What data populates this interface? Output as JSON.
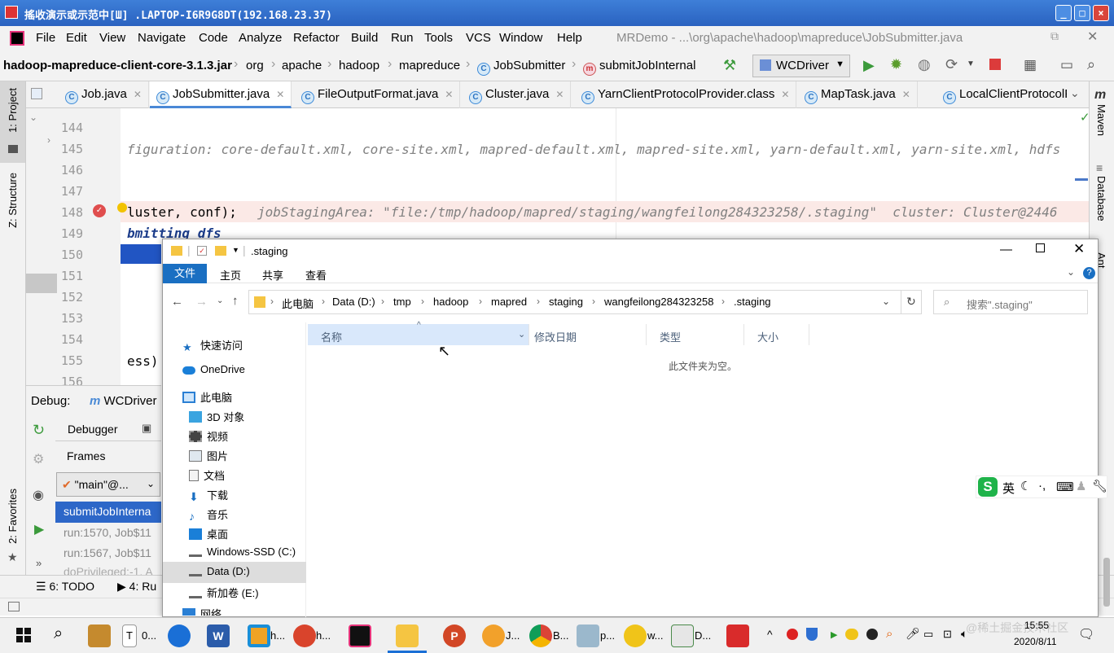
{
  "remote_window": {
    "title": "搖收演示或示范中[Ш] .LAPTOP-I6R9G8DT(192.168.23.37)"
  },
  "menu": [
    "File",
    "Edit",
    "View",
    "Navigate",
    "Code",
    "Analyze",
    "Refactor",
    "Build",
    "Run",
    "Tools",
    "VCS",
    "Window",
    "Help"
  ],
  "project_path": "MRDemo - ...\\org\\apache\\hadoop\\mapreduce\\JobSubmitter.java",
  "breadcrumbs": [
    "hadoop-mapreduce-client-core-3.1.3.jar",
    "org",
    "apache",
    "hadoop",
    "mapreduce",
    "JobSubmitter",
    "submitJobInternal"
  ],
  "run_config": "WCDriver",
  "tabs": [
    "Job.java",
    "JobSubmitter.java",
    "FileOutputFormat.java",
    "Cluster.java",
    "YarnClientProtocolProvider.class",
    "MapTask.java",
    "LocalClientProtocolPr"
  ],
  "left_tools": {
    "project": "1: Project",
    "structure": "Z: Structure",
    "favorites": "2: Favorites"
  },
  "right_tools": {
    "maven": "Maven",
    "database": "Database",
    "ant": "Ant"
  },
  "line_numbers": [
    "144",
    "145",
    "146",
    "147",
    "148",
    "149",
    "150",
    "151",
    "152",
    "153",
    "154",
    "155",
    "156"
  ],
  "code": {
    "l145": "figuration: core-default.xml, core-site.xml, mapred-default.xml, mapred-site.xml, yarn-default.xml, yarn-site.xml, hdfs",
    "l148_code": "luster, conf);",
    "l148_hint": "jobStagingArea: \"file:/tmp/hadoop/mapred/staging/wangfeilong284323258/.staging\"  cluster: Cluster@2446",
    "l149": "bmitting dfs",
    "l155": "ess)"
  },
  "debug": {
    "label": "Debug:",
    "config": "WCDriver",
    "debugger_tab": "Debugger",
    "frames_label": "Frames",
    "thread": "\"main\"@...",
    "frames": [
      "submitJobInterna",
      "run:1570, Job$11",
      "run:1567, Job$11",
      "doPrivileged:-1, A"
    ]
  },
  "bottom_tools": {
    "todo": "6: TODO",
    "run": "4: Ru"
  },
  "explorer": {
    "title": ".staging",
    "ribbon": [
      "文件",
      "主页",
      "共享",
      "查看"
    ],
    "address": [
      "此电脑",
      "Data (D:)",
      "tmp",
      "hadoop",
      "mapred",
      "staging",
      "wangfeilong284323258",
      ".staging"
    ],
    "search_placeholder": "搜索\".staging\"",
    "nav": [
      "快速访问",
      "OneDrive",
      "此电脑",
      "3D 对象",
      "视频",
      "图片",
      "文档",
      "下载",
      "音乐",
      "桌面",
      "Windows-SSD (C:)",
      "Data (D:)",
      "新加卷 (E:)",
      "网络"
    ],
    "columns": [
      "名称",
      "修改日期",
      "类型",
      "大小"
    ],
    "empty_text": "此文件夹为空。"
  },
  "taskbar": {
    "items": [
      "0...",
      "h...",
      "h...",
      "J...",
      "B...",
      "p...",
      "w...",
      "D..."
    ],
    "ime_lang": "英",
    "time": "15:55",
    "date": "2020/8/11",
    "watermark": "@稀土掘金技术社区"
  }
}
